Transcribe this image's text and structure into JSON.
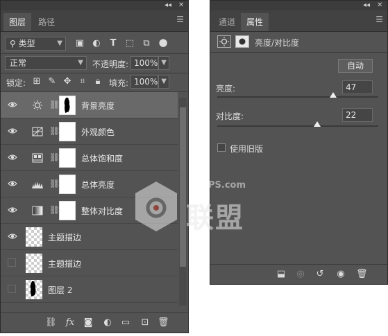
{
  "layers_panel": {
    "tabs": [
      {
        "label": "图层"
      },
      {
        "label": "路径"
      }
    ],
    "filter_kind": "类型",
    "blend_mode": "正常",
    "opacity_label": "不透明度:",
    "opacity_value": "100%",
    "lock_label": "锁定:",
    "fill_label": "填充:",
    "fill_value": "100%",
    "layers": [
      {
        "name": "背景亮度",
        "visible": true,
        "selected": true,
        "adjustment_icon": "sun-icon"
      },
      {
        "name": "外观颜色",
        "visible": true,
        "selected": false,
        "adjustment_icon": "selective-color-icon"
      },
      {
        "name": "总体饱和度",
        "visible": true,
        "selected": false,
        "adjustment_icon": "hue-saturation-icon"
      },
      {
        "name": "总体亮度",
        "visible": true,
        "selected": false,
        "adjustment_icon": "levels-icon"
      },
      {
        "name": "整体对比度",
        "visible": true,
        "selected": false,
        "adjustment_icon": "gradient-map-icon"
      },
      {
        "name": "主题描边",
        "visible": true,
        "selected": false,
        "adjustment_icon": ""
      },
      {
        "name": "主题描边",
        "visible": false,
        "selected": false,
        "adjustment_icon": ""
      },
      {
        "name": "图层 2",
        "visible": false,
        "selected": false,
        "adjustment_icon": ""
      }
    ]
  },
  "properties_panel": {
    "tabs": [
      {
        "label": "通道"
      },
      {
        "label": "属性"
      }
    ],
    "title": "亮度/对比度",
    "auto_button": "自动",
    "brightness_label": "亮度:",
    "brightness_value": "47",
    "brightness_fraction": 0.72,
    "contrast_label": "对比度:",
    "contrast_value": "22",
    "contrast_fraction": 0.62,
    "use_legacy_label": "使用旧版",
    "use_legacy_checked": false
  },
  "watermark": {
    "text_top": "PS.com",
    "text_main": "联盟"
  },
  "colors": {
    "panel_bg": "#535353",
    "selected_row": "#696969",
    "text": "#e8e8e8"
  }
}
